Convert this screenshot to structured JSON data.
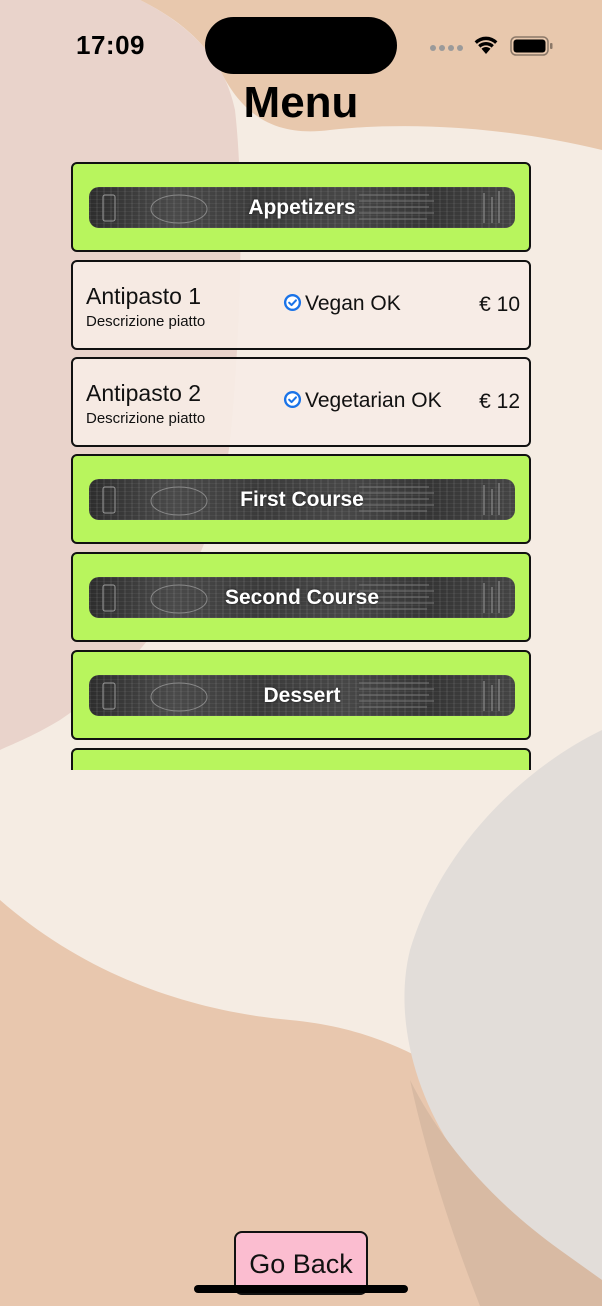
{
  "status_bar": {
    "time": "17:09",
    "wifi_icon": "wifi-icon",
    "battery_icon": "battery-icon"
  },
  "page": {
    "title": "Menu"
  },
  "menu": {
    "items": [
      {
        "kind": "category",
        "label": "Appetizers"
      },
      {
        "kind": "dish",
        "name": "Antipasto 1",
        "description": "Descrizione piatto",
        "diet": "Vegan OK",
        "price": "€ 10",
        "diet_icon": "check-circle-icon"
      },
      {
        "kind": "dish",
        "name": "Antipasto 2",
        "description": "Descrizione piatto",
        "diet": "Vegetarian OK",
        "price": "€ 12",
        "diet_icon": "check-circle-icon"
      },
      {
        "kind": "category",
        "label": "First Course"
      },
      {
        "kind": "category",
        "label": "Second Course"
      },
      {
        "kind": "category",
        "label": "Dessert"
      },
      {
        "kind": "category",
        "label": ""
      }
    ]
  },
  "footer": {
    "back_label": "Go Back"
  },
  "colors": {
    "category_bg": "#b8f55d",
    "back_button_bg": "#fbbdd0",
    "check_icon": "#1a73e8"
  }
}
